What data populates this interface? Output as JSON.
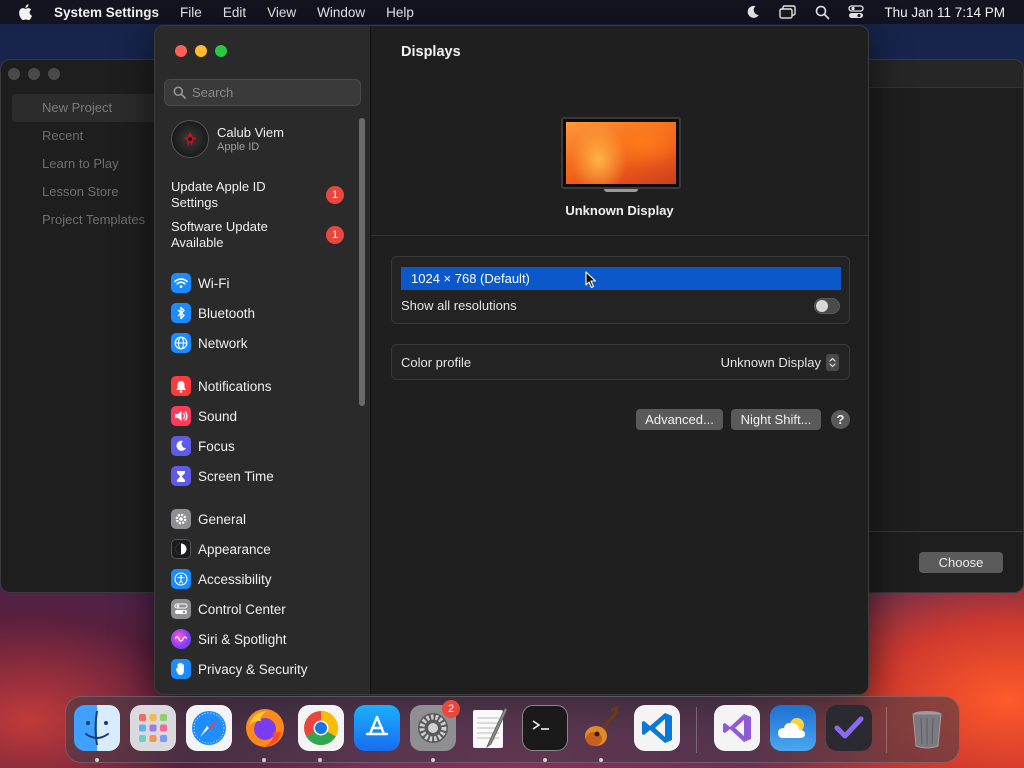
{
  "menubar": {
    "app_name": "System Settings",
    "menus": [
      "File",
      "Edit",
      "View",
      "Window",
      "Help"
    ],
    "clock": "Thu Jan 11  7:14 PM"
  },
  "bg_app": {
    "items": [
      "New Project",
      "Recent",
      "Learn to Play",
      "Lesson Store",
      "Project Templates"
    ],
    "choose_label": "Choose"
  },
  "sidebar": {
    "search_placeholder": "Search",
    "account": {
      "name": "Calub Viem",
      "subtitle": "Apple ID"
    },
    "notices": [
      {
        "label": "Update Apple ID Settings",
        "badge": "1"
      },
      {
        "label": "Software Update Available",
        "badge": "1"
      }
    ],
    "items": [
      {
        "label": "Wi-Fi",
        "icon": "wifi-icon",
        "color": "#1a8cff"
      },
      {
        "label": "Bluetooth",
        "icon": "bluetooth-icon",
        "color": "#1a8cff"
      },
      {
        "label": "Network",
        "icon": "network-globe-icon",
        "color": "#1a8cff"
      },
      {
        "label": "Notifications",
        "icon": "notifications-bell-icon",
        "color": "#ff3b3b"
      },
      {
        "label": "Sound",
        "icon": "sound-speaker-icon",
        "color": "#ff3b5c"
      },
      {
        "label": "Focus",
        "icon": "focus-moon-icon",
        "color": "#5e5ce6"
      },
      {
        "label": "Screen Time",
        "icon": "screen-time-hourglass-icon",
        "color": "#5e5ce6"
      },
      {
        "label": "General",
        "icon": "general-gear-icon",
        "color": "#8e8e93"
      },
      {
        "label": "Appearance",
        "icon": "appearance-icon",
        "color": "#1c1c1e"
      },
      {
        "label": "Accessibility",
        "icon": "accessibility-icon",
        "color": "#1a8cff"
      },
      {
        "label": "Control Center",
        "icon": "control-center-icon",
        "color": "#8e8e93"
      },
      {
        "label": "Siri & Spotlight",
        "icon": "siri-icon",
        "color": "#b04ad8"
      },
      {
        "label": "Privacy & Security",
        "icon": "privacy-hand-icon",
        "color": "#1a8cff"
      }
    ]
  },
  "content": {
    "title": "Displays",
    "display_name": "Unknown Display",
    "resolution": "1024 × 768 (Default)",
    "show_all_label": "Show all resolutions",
    "show_all_enabled": false,
    "color_profile_label": "Color profile",
    "color_profile_value": "Unknown Display",
    "advanced_label": "Advanced...",
    "night_shift_label": "Night Shift...",
    "help_label": "?"
  },
  "dock": {
    "badge_settings": "2",
    "apps": [
      "finder",
      "launchpad",
      "safari",
      "firefox",
      "chrome",
      "app-store",
      "system-settings",
      "textedit",
      "terminal",
      "garageband",
      "vscode",
      "visual-studio",
      "weather",
      "omnifocus",
      "trash"
    ]
  }
}
